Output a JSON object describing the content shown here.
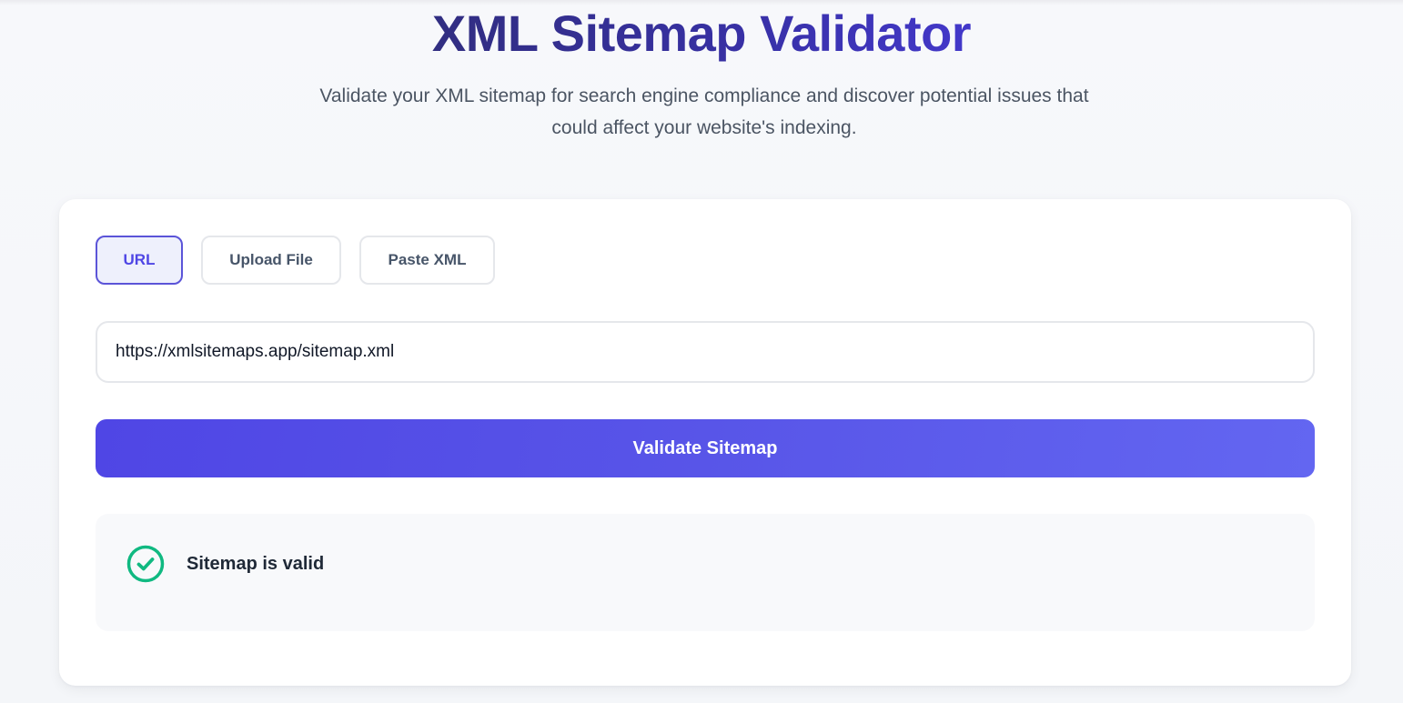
{
  "header": {
    "title": "XML Sitemap Validator",
    "subtitle": "Validate your XML sitemap for search engine compliance and discover potential issues that could affect your website's indexing."
  },
  "tabs": [
    {
      "label": "URL",
      "active": true
    },
    {
      "label": "Upload File",
      "active": false
    },
    {
      "label": "Paste XML",
      "active": false
    }
  ],
  "url_input": {
    "value": "https://xmlsitemaps.app/sitemap.xml"
  },
  "validate_button": {
    "label": "Validate Sitemap"
  },
  "result": {
    "icon": "check-circle-icon",
    "status_text": "Sitemap is valid",
    "status_color": "#10b981"
  },
  "colors": {
    "accent": "#4f46e5",
    "title": "#312e81"
  }
}
